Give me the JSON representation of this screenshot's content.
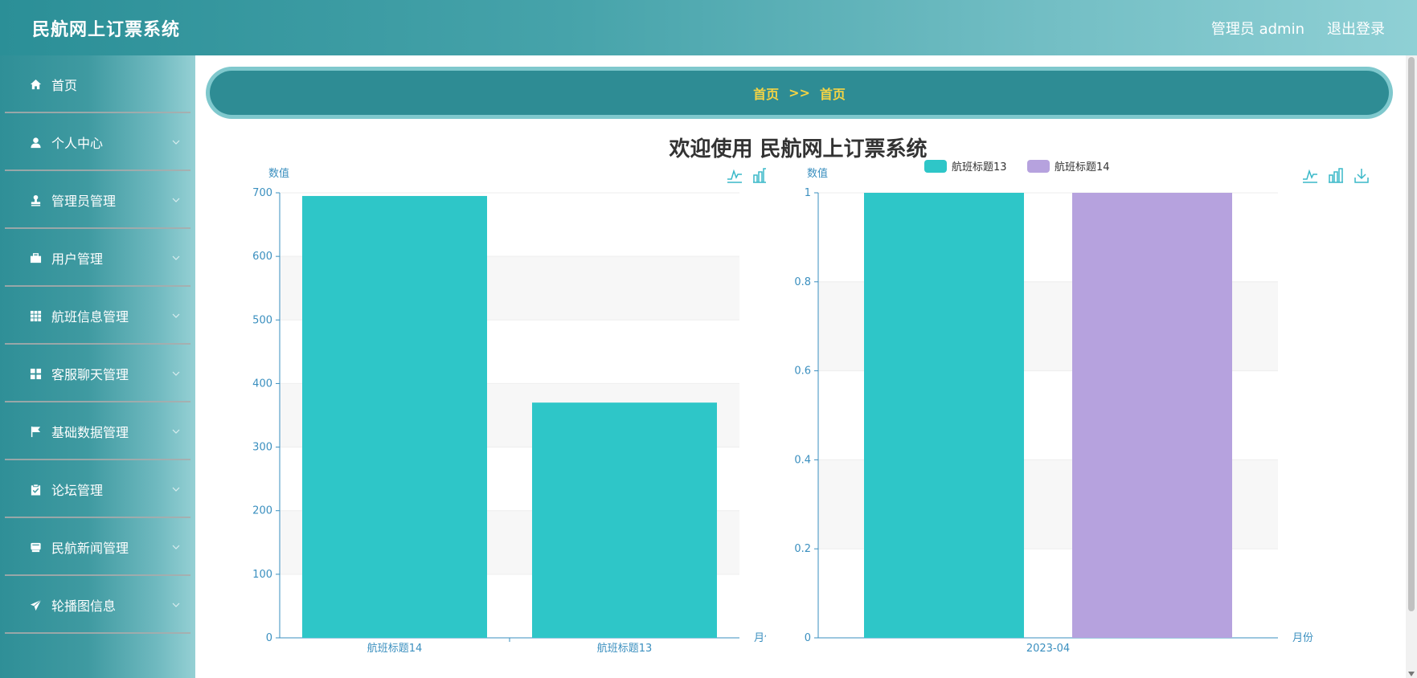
{
  "header": {
    "title": "民航网上订票系统",
    "user_label": "管理员 admin",
    "logout_label": "退出登录"
  },
  "sidebar": {
    "items": [
      {
        "label": "首页",
        "icon": "home-icon",
        "has_children": false
      },
      {
        "label": "个人中心",
        "icon": "user-icon",
        "has_children": true
      },
      {
        "label": "管理员管理",
        "icon": "stamp-icon",
        "has_children": true
      },
      {
        "label": "用户管理",
        "icon": "briefcase-icon",
        "has_children": true
      },
      {
        "label": "航班信息管理",
        "icon": "grid-icon",
        "has_children": true
      },
      {
        "label": "客服聊天管理",
        "icon": "apps-icon",
        "has_children": true
      },
      {
        "label": "基础数据管理",
        "icon": "flag-icon",
        "has_children": true
      },
      {
        "label": "论坛管理",
        "icon": "clipboard-icon",
        "has_children": true
      },
      {
        "label": "民航新闻管理",
        "icon": "news-icon",
        "has_children": true
      },
      {
        "label": "轮播图信息",
        "icon": "send-icon",
        "has_children": true
      }
    ]
  },
  "breadcrumb": {
    "root": "首页",
    "separator": ">>",
    "current": "首页"
  },
  "welcome_title": "欢迎使用 民航网上订票系统",
  "colors": {
    "accent": "#2e8c94",
    "breadcrumb_text": "#f5d443",
    "bar_primary": "#2ec6c8",
    "bar_secondary": "#b6a2de",
    "axis": "#3a8fbf"
  },
  "chart_data": [
    {
      "type": "bar",
      "categories": [
        "航班标题14",
        "航班标题13"
      ],
      "values": [
        695,
        370
      ],
      "ylabel": "数值",
      "xlabel": "月份",
      "ylim": [
        0,
        700
      ],
      "yticks": [
        0,
        100,
        200,
        300,
        400,
        500,
        600,
        700
      ],
      "grid": true,
      "toolbox": [
        "line-chart-icon",
        "bar-chart-icon",
        "download-icon"
      ]
    },
    {
      "type": "bar",
      "categories": [
        "2023-04"
      ],
      "series": [
        {
          "name": "航班标题13",
          "values": [
            1
          ]
        },
        {
          "name": "航班标题14",
          "values": [
            1
          ]
        }
      ],
      "ylabel": "数值",
      "xlabel": "月份",
      "ylim": [
        0,
        1
      ],
      "yticks": [
        "0",
        "0.2",
        "0.4",
        "0.6",
        "0.8",
        "1"
      ],
      "legend": "top-center",
      "grid": true,
      "toolbox": [
        "line-chart-icon",
        "bar-chart-icon",
        "download-icon"
      ]
    }
  ]
}
